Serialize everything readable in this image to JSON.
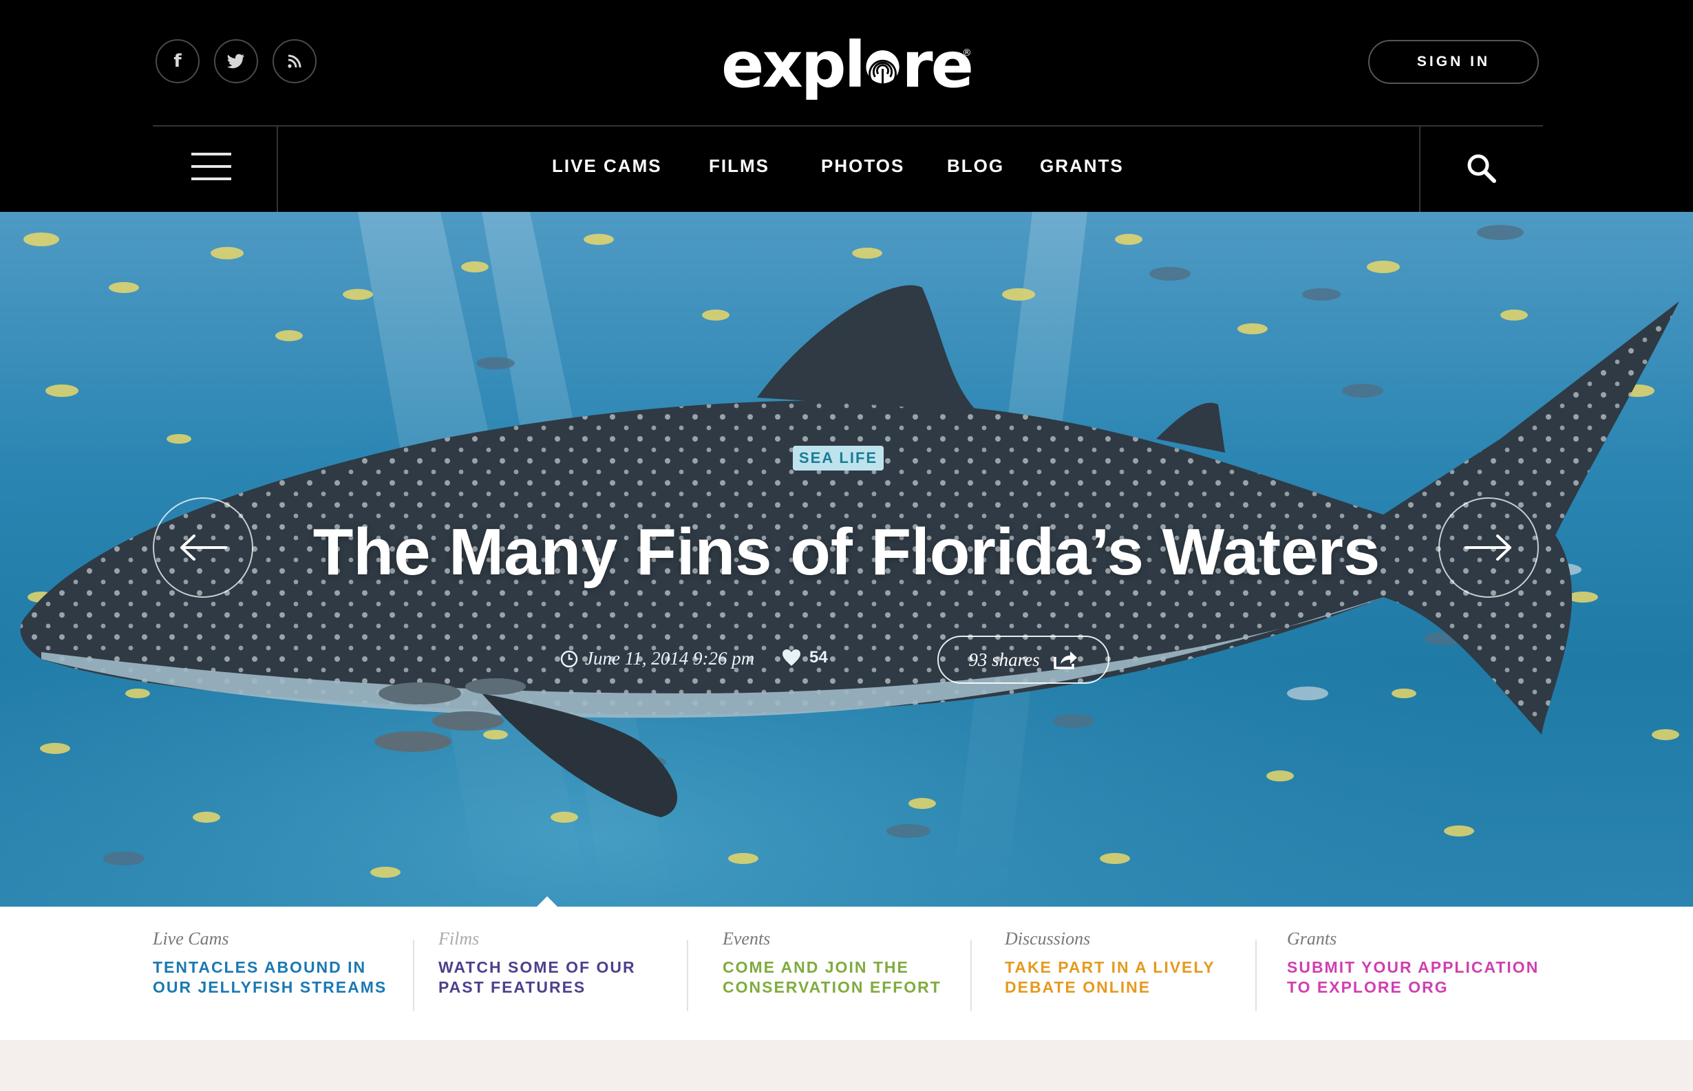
{
  "header": {
    "social": [
      {
        "icon": "facebook-icon",
        "glyph": "f"
      },
      {
        "icon": "twitter-icon",
        "glyph": "❧"
      },
      {
        "icon": "rss-icon",
        "glyph": ")"
      }
    ],
    "logo_text_before": "expl",
    "logo_text_after": "re",
    "logo_registered": "®",
    "sign_in": "SIGN IN"
  },
  "nav": {
    "items": [
      "LIVE CAMS",
      "FILMS",
      "PHOTOS",
      "BLOG",
      "GRANTS"
    ]
  },
  "hero": {
    "tag": "SEA LIFE",
    "title": "The Many Fins of Florida’s Waters",
    "date": "June 11, 2014 9:26 pm",
    "likes": "54",
    "shares": "93 shares"
  },
  "features": [
    {
      "category": "Live Cams",
      "title_line1": "TENTACLES ABOUND IN",
      "title_line2": "OUR JELLYFISH STREAMS",
      "color": "#1a78b4"
    },
    {
      "category": "Films",
      "title_line1": "WATCH SOME OF OUR",
      "title_line2": "PAST FEATURES",
      "color": "#4e3f8c"
    },
    {
      "category": "Events",
      "title_line1": "COME AND JOIN THE",
      "title_line2": "CONSERVATION EFFORT",
      "color": "#7fab3e"
    },
    {
      "category": "Discussions",
      "title_line1": "TAKE PART IN A LIVELY",
      "title_line2": "DEBATE ONLINE",
      "color": "#e59a1f"
    },
    {
      "category": "Grants",
      "title_line1": "SUBMIT YOUR APPLICATION",
      "title_line2": "TO EXPLORE ORG",
      "color": "#cf3fb0"
    }
  ]
}
